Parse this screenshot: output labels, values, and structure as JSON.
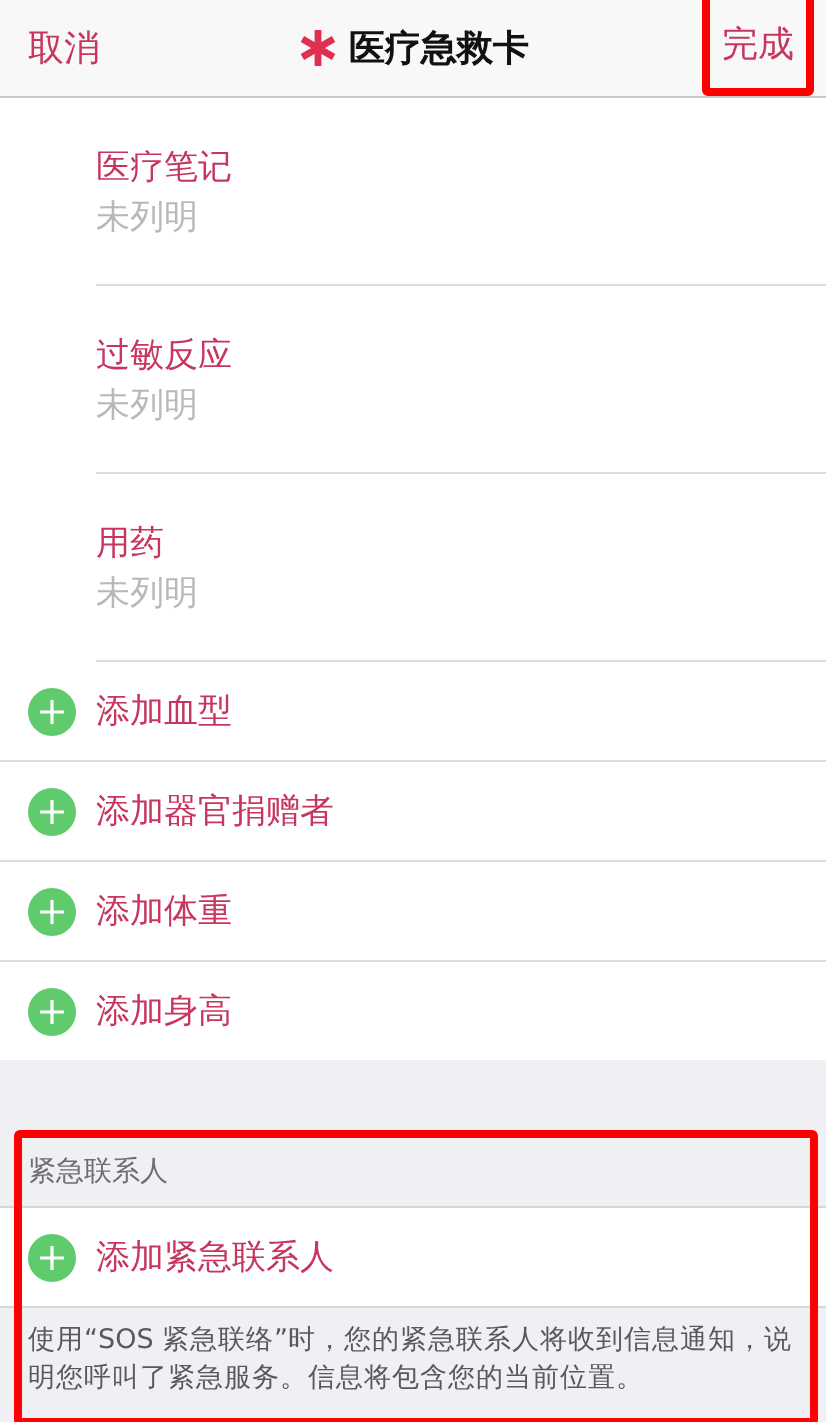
{
  "nav": {
    "cancel": "取消",
    "title": "医疗急救卡",
    "done": {
      "label": "完成",
      "highlighted": true
    }
  },
  "fields": [
    {
      "label": "医疗笔记",
      "placeholder": "未列明"
    },
    {
      "label": "过敏反应",
      "placeholder": "未列明"
    },
    {
      "label": "用药",
      "placeholder": "未列明"
    }
  ],
  "add_rows": [
    "添加血型",
    "添加器官捐赠者",
    "添加体重",
    "添加身高"
  ],
  "contacts": {
    "header": "紧急联系人",
    "highlighted": true,
    "add_row": "添加紧急联系人",
    "footer": "使用“SOS 紧急联络”时，您的紧急联系人将收到信息通知，说明您呼叫了紧急服务。信息将包含您的当前位置。"
  }
}
